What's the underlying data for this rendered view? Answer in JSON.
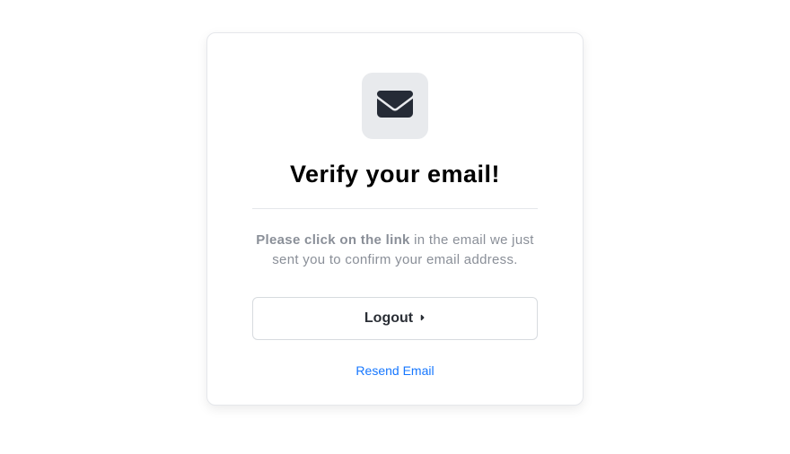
{
  "card": {
    "title": "Verify your email!",
    "instruction_bold": "Please click on the link",
    "instruction_rest": " in the email we just sent you to confirm your email address.",
    "logout_label": "Logout",
    "resend_label": "Resend Email"
  },
  "icons": {
    "envelope": "envelope-icon",
    "caret_right": "caret-right-icon"
  }
}
